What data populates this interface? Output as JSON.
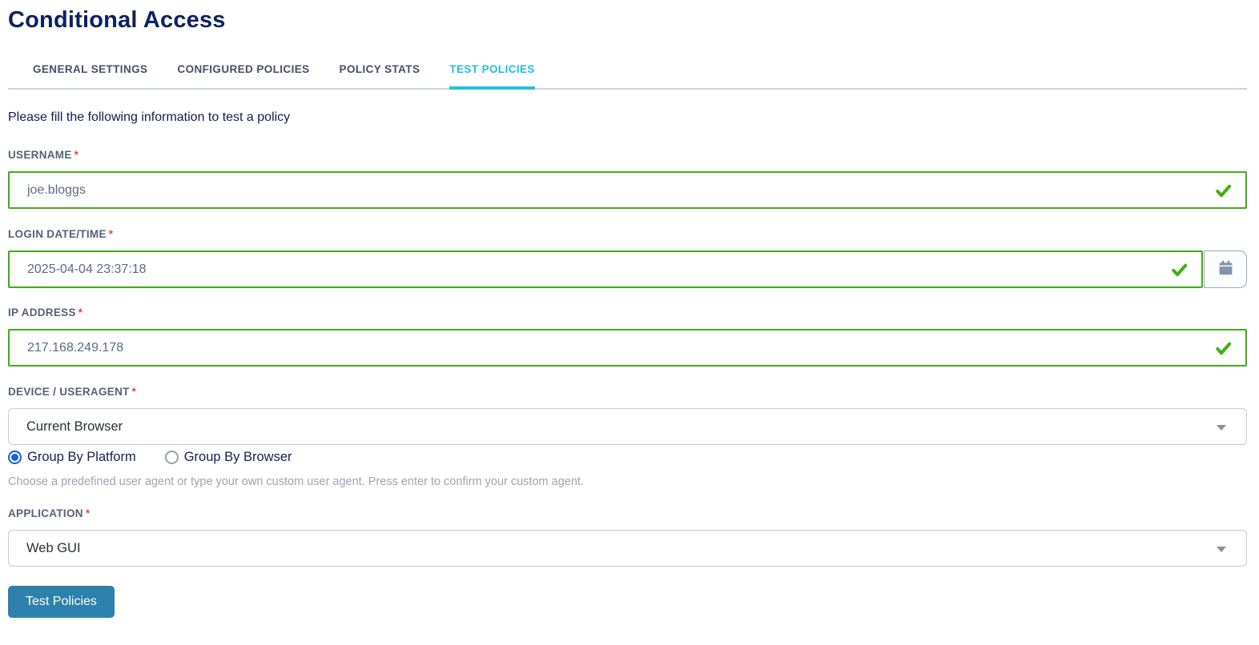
{
  "page": {
    "title": "Conditional Access"
  },
  "tabs": [
    {
      "label": "GENERAL SETTINGS",
      "active": false
    },
    {
      "label": "CONFIGURED POLICIES",
      "active": false
    },
    {
      "label": "POLICY STATS",
      "active": false
    },
    {
      "label": "TEST POLICIES",
      "active": true
    }
  ],
  "intro": "Please fill the following information to test a policy",
  "form": {
    "required_marker": "*",
    "username": {
      "label": "USERNAME",
      "value": "joe.bloggs",
      "valid": true
    },
    "login_datetime": {
      "label": "LOGIN DATE/TIME",
      "value": "2025-04-04 23:37:18",
      "valid": true
    },
    "ip_address": {
      "label": "IP ADDRESS",
      "value": "217.168.249.178",
      "valid": true
    },
    "device_useragent": {
      "label": "DEVICE / USERAGENT",
      "selected_value": "Current Browser",
      "radios": [
        {
          "label": "Group By Platform",
          "selected": true
        },
        {
          "label": "Group By Browser",
          "selected": false
        }
      ],
      "help": "Choose a predefined user agent or type your own custom user agent. Press enter to confirm your custom agent."
    },
    "application": {
      "label": "APPLICATION",
      "selected_value": "Web GUI"
    },
    "submit_label": "Test Policies"
  },
  "icons": {
    "valid": "check-icon",
    "date_picker": "calendar-icon",
    "dropdown": "chevron-down-icon"
  },
  "colors": {
    "title_navy": "#0e2160",
    "tab_active_cyan": "#23bfdf",
    "tab_inactive": "#454f66",
    "valid_green": "#3fae14",
    "label_gray": "#566176",
    "required_red": "#e14b4b",
    "input_text": "#5c6a86",
    "radio_blue": "#1563dd",
    "helper_gray": "#9ca4b3",
    "button_blue": "#2e81ab"
  }
}
